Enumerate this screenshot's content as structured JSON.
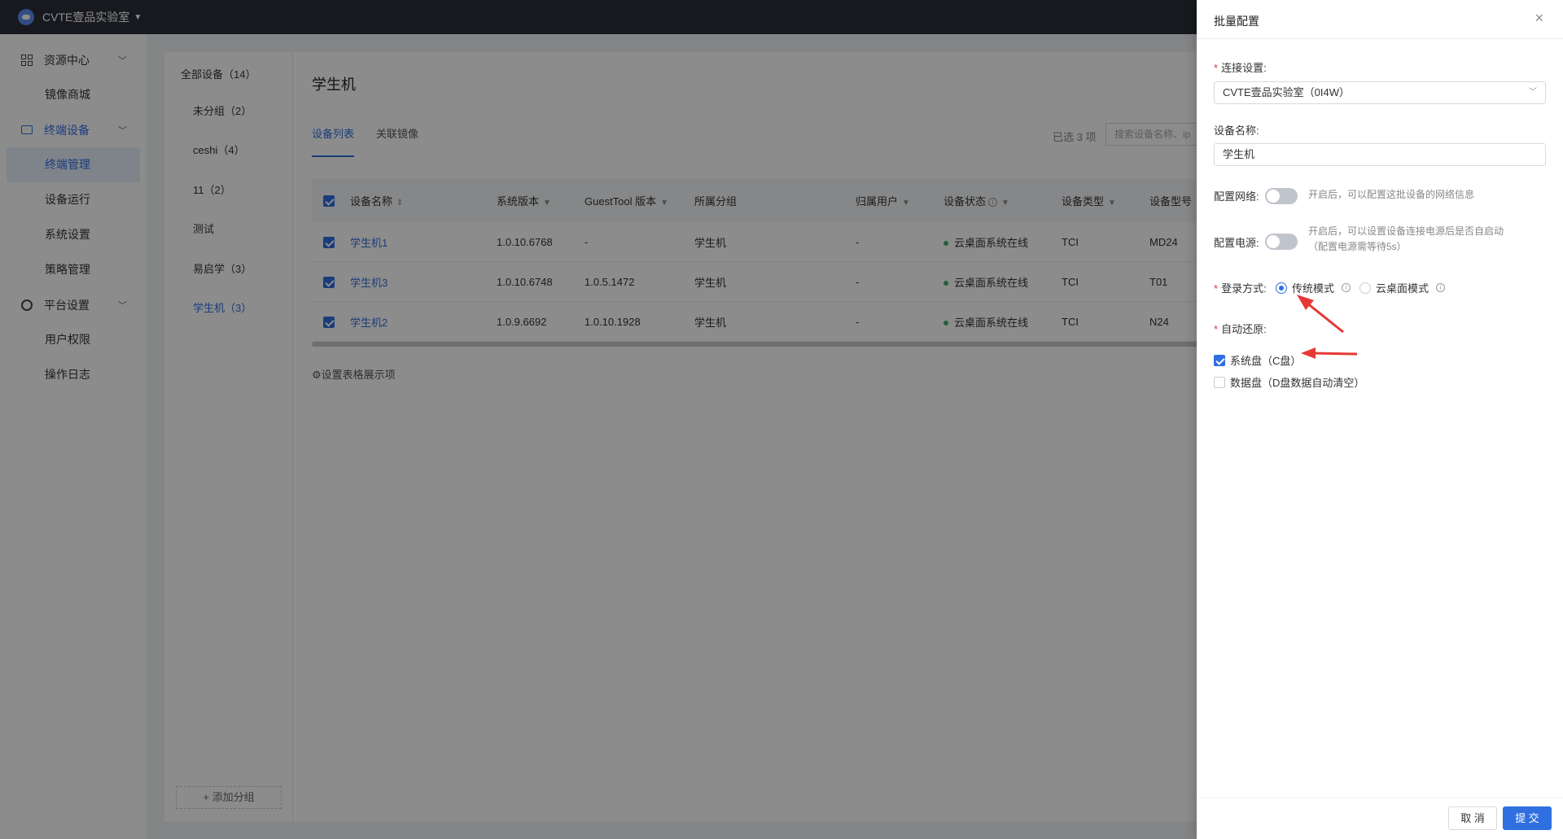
{
  "topbar": {
    "title": "CVTE壹品实验室"
  },
  "sidenav": {
    "groups": [
      {
        "label": "资源中心",
        "items": [
          "镜像商城"
        ]
      },
      {
        "label": "终端设备",
        "items": [
          "终端管理",
          "设备运行",
          "系统设置",
          "策略管理"
        ]
      },
      {
        "label": "平台设置",
        "items": [
          "用户权限",
          "操作日志"
        ]
      }
    ]
  },
  "groups": {
    "items": [
      "全部设备（14）",
      "未分组（2）",
      "ceshi（4）",
      "11（2）",
      "测试",
      "易启学（3）",
      "学生机（3）"
    ],
    "add_label": "+ 添加分组"
  },
  "main": {
    "title": "学生机",
    "tabs": [
      "设备列表",
      "关联镜像"
    ],
    "selected_count": "已选 3 项",
    "search_placeholder": "搜索设备名称、ip",
    "columns": [
      "设备名称",
      "系统版本",
      "GuestTool 版本",
      "所属分组",
      "归属用户",
      "设备状态",
      "设备类型",
      "设备型号"
    ],
    "rows": [
      {
        "name": "学生机1",
        "sys": "1.0.10.6768",
        "gt": "-",
        "group": "学生机",
        "user": "-",
        "status": "云桌面系统在线",
        "type": "TCI",
        "model": "MD24"
      },
      {
        "name": "学生机3",
        "sys": "1.0.10.6748",
        "gt": "1.0.5.1472",
        "group": "学生机",
        "user": "-",
        "status": "云桌面系统在线",
        "type": "TCI",
        "model": "T01"
      },
      {
        "name": "学生机2",
        "sys": "1.0.9.6692",
        "gt": "1.0.10.1928",
        "group": "学生机",
        "user": "-",
        "status": "云桌面系统在线",
        "type": "TCI",
        "model": "N24"
      }
    ],
    "col_settings": "设置表格展示项"
  },
  "drawer": {
    "title": "批量配置",
    "connection_label": "连接设置:",
    "connection_value": "CVTE壹品实验室（0I4W）",
    "name_label": "设备名称:",
    "name_value": "学生机",
    "network_label": "配置网络:",
    "network_hint": "开启后，可以配置这批设备的网络信息",
    "power_label": "配置电源:",
    "power_hint_1": "开启后，可以设置设备连接电源后是否自启动",
    "power_hint_2": "（配置电源需等待5s）",
    "login_label": "登录方式:",
    "login_opt1": "传统模式",
    "login_opt2": "云桌面模式",
    "restore_label": "自动还原:",
    "restore_opt1": "系统盘（C盘）",
    "restore_opt2": "数据盘（D盘数据自动清空）",
    "cancel": "取 消",
    "submit": "提 交"
  },
  "colors": {
    "accent": "#2f6fe0",
    "topbar": "#2b2f3a",
    "online": "#3bb36b",
    "annotation": "#e53935"
  }
}
